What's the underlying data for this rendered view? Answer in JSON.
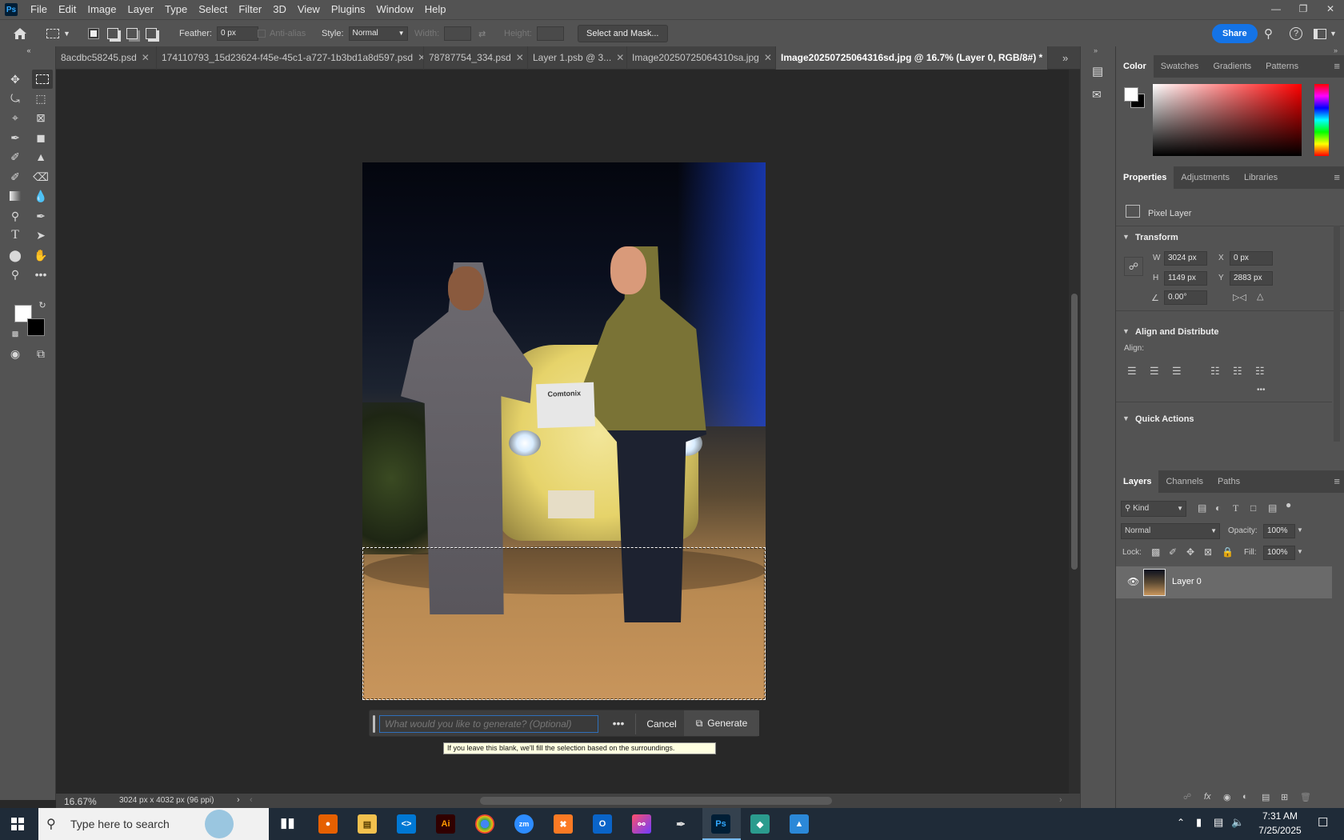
{
  "app": {
    "logo": "Ps"
  },
  "menu": [
    "File",
    "Edit",
    "Image",
    "Layer",
    "Type",
    "Select",
    "Filter",
    "3D",
    "View",
    "Plugins",
    "Window",
    "Help"
  ],
  "window_controls": [
    "minimize-icon",
    "restore-icon",
    "close-icon"
  ],
  "options": {
    "feather_label": "Feather:",
    "feather_value": "0 px",
    "antialias_label": "Anti-alias",
    "style_label": "Style:",
    "style_value": "Normal",
    "width_label": "Width:",
    "height_label": "Height:",
    "select_mask": "Select and Mask...",
    "share": "Share"
  },
  "tabs": [
    {
      "label": "8acdbc58245.psd"
    },
    {
      "label": "174110793_15d23624-f45e-45c1-a727-1b3bd1a8d597.psd"
    },
    {
      "label": "78787754_334.psd"
    },
    {
      "label": "Layer 1.psb @ 3..."
    },
    {
      "label": "Image20250725064310sa.jpg"
    },
    {
      "label": "Image20250725064316sd.jpg @ 16.7% (Layer 0, RGB/8#) *"
    }
  ],
  "photo": {
    "paper_text": "Comtonix"
  },
  "gen_bar": {
    "placeholder": "What would you like to generate? (Optional)",
    "more": "•••",
    "cancel": "Cancel",
    "generate": "Generate",
    "tooltip": "If you leave this blank, we'll fill the selection based on the surroundings."
  },
  "status": {
    "zoom": "16.67%",
    "doc_info": "3024 px x 4032 px (96 ppi)"
  },
  "color_panel": {
    "tabs": [
      "Color",
      "Swatches",
      "Gradients",
      "Patterns"
    ]
  },
  "properties_panel": {
    "tabs": [
      "Properties",
      "Adjustments",
      "Libraries"
    ],
    "pixel_layer": "Pixel Layer",
    "transform_label": "Transform",
    "w_label": "W",
    "w_value": "3024 px",
    "h_label": "H",
    "h_value": "1149 px",
    "x_label": "X",
    "x_value": "0 px",
    "y_label": "Y",
    "y_value": "2883 px",
    "angle_value": "0.00°",
    "align_distribute": "Align and Distribute",
    "align_label": "Align:",
    "quick_actions": "Quick Actions"
  },
  "layers_panel": {
    "tabs": [
      "Layers",
      "Channels",
      "Paths"
    ],
    "kind": "Kind",
    "blend": "Normal",
    "opacity_label": "Opacity:",
    "opacity_value": "100%",
    "lock_label": "Lock:",
    "fill_label": "Fill:",
    "fill_value": "100%",
    "layer_name": "Layer 0"
  },
  "taskbar": {
    "search_placeholder": "Type here to search",
    "time": "7:31 AM",
    "date": "7/25/2025",
    "apps": [
      "Firefox",
      "File Explorer",
      "VS Code",
      "Illustrator",
      "Chrome",
      "Zoom",
      "XAMPP",
      "Outlook",
      "Creative Cloud",
      "Pen",
      "Photoshop",
      "App",
      "Photos"
    ]
  },
  "colors": {
    "accent": "#1473e6",
    "ui_bg": "#535353",
    "canvas_bg": "#282828",
    "tooltip_bg": "#ffffe1"
  }
}
